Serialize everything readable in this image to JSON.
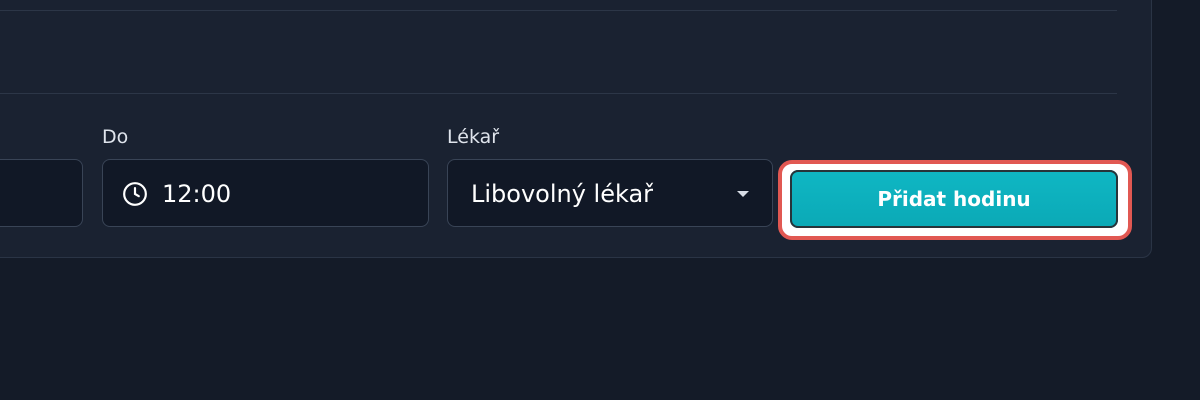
{
  "form": {
    "to": {
      "label": "Do",
      "value": "12:00",
      "icon": "clock-icon"
    },
    "doctor": {
      "label": "Lékař",
      "selected": "Libovolný lékař",
      "icon": "caret-down-icon"
    },
    "submit_label": "Přidat hodinu"
  },
  "colors": {
    "background": "#141b28",
    "card": "#1a2231",
    "input": "#111826",
    "accent": "#0fb7c4",
    "highlight": "#e15852"
  }
}
